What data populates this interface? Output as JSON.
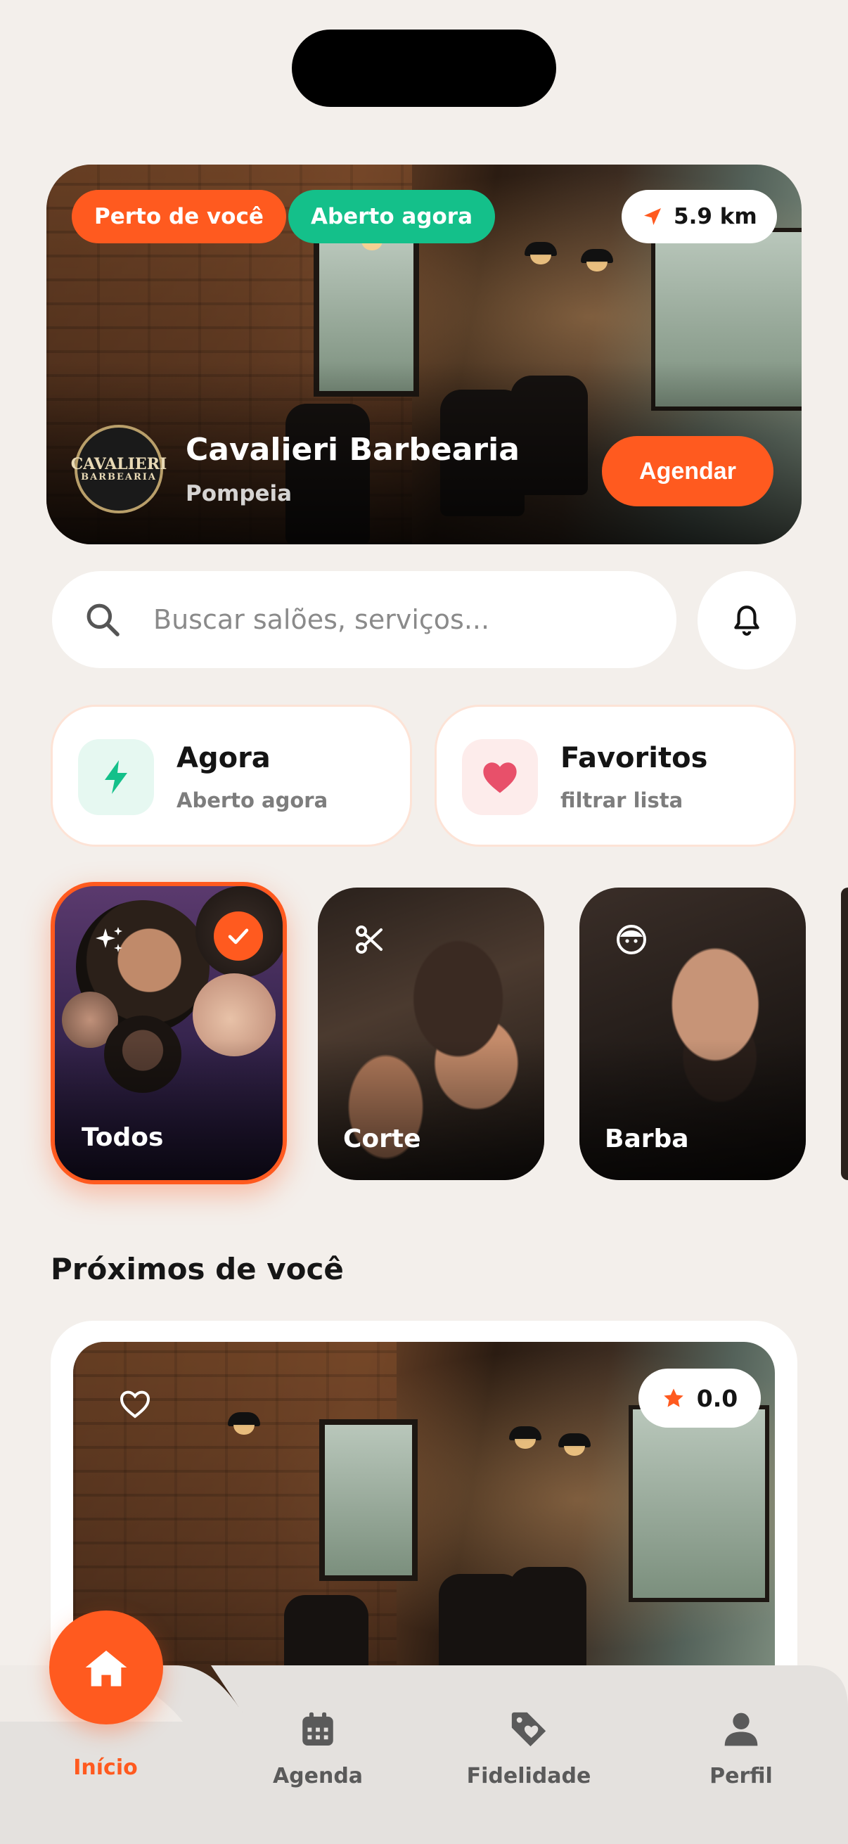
{
  "colors": {
    "accent": "#ff5a1f",
    "success": "#14c08a",
    "background": "#f3efeb",
    "favorite": "#e8506a"
  },
  "hero": {
    "badge_near": "Perto de você",
    "badge_open": "Aberto agora",
    "distance": "5.9 km",
    "shop_name": "Cavalieri Barbearia",
    "neighborhood": "Pompeia",
    "book_label": "Agendar",
    "logo_text": "CAVALIERI",
    "logo_sub": "BARBEARIA"
  },
  "search": {
    "placeholder": "Buscar salões, serviços..."
  },
  "quick_filters": [
    {
      "title": "Agora",
      "subtitle": "Aberto agora",
      "icon": "lightning-icon"
    },
    {
      "title": "Favoritos",
      "subtitle": "filtrar lista",
      "icon": "heart-icon"
    }
  ],
  "categories": [
    {
      "label": "Todos",
      "icon": "sparkles-icon",
      "selected": true
    },
    {
      "label": "Corte",
      "icon": "scissors-icon",
      "selected": false
    },
    {
      "label": "Barba",
      "icon": "face-icon",
      "selected": false
    }
  ],
  "section": {
    "title": "Próximos de você"
  },
  "shop_card": {
    "rating": "0.0"
  },
  "nav": {
    "items": [
      {
        "label": "Início",
        "icon": "home-icon",
        "active": true
      },
      {
        "label": "Agenda",
        "icon": "calendar-icon",
        "active": false
      },
      {
        "label": "Fidelidade",
        "icon": "tag-heart-icon",
        "active": false
      },
      {
        "label": "Perfil",
        "icon": "user-icon",
        "active": false
      }
    ]
  }
}
